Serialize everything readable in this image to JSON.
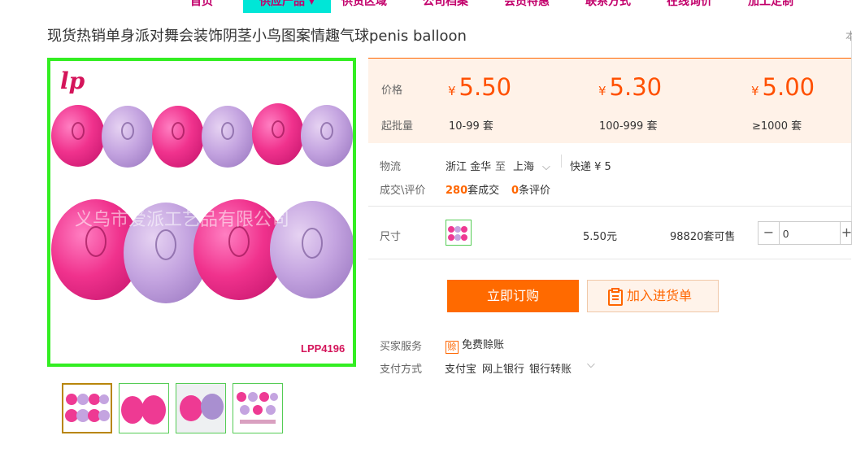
{
  "nav": {
    "items": [
      {
        "label": "首页"
      },
      {
        "label": "供应产品 ▾"
      },
      {
        "label": "供货区域"
      },
      {
        "label": "公司档案"
      },
      {
        "label": "会员特惠"
      },
      {
        "label": "联系方式"
      },
      {
        "label": "在线询价"
      },
      {
        "label": "加工定制"
      }
    ]
  },
  "product": {
    "title": "现货热销单身派对舞会装饰阴茎小鸟图案情趣气球penis balloon",
    "title_right": "本"
  },
  "images": {
    "brand_mark": "lp",
    "watermark": "义乌市爱派工艺品有限公司",
    "sku_code": "LPP4196",
    "thumbnails": [
      {
        "alt": "thumb-1"
      },
      {
        "alt": "thumb-2"
      },
      {
        "alt": "thumb-3"
      },
      {
        "alt": "thumb-4"
      }
    ]
  },
  "pricing": {
    "price_label": "价格",
    "moq_label": "起批量",
    "currency": "¥",
    "tiers": [
      {
        "price": "5.50",
        "range": "10-99 套"
      },
      {
        "price": "5.30",
        "range": "100-999 套"
      },
      {
        "price": "5.00",
        "range": "≥1000 套"
      }
    ]
  },
  "logistics": {
    "label": "物流",
    "from": "浙江 金华",
    "to_word": "至",
    "to": "上海",
    "shipping": "快递 ¥ 5"
  },
  "deals": {
    "label": "成交\\评价",
    "sold_count": "280",
    "sold_suffix": "套成交",
    "review_count": "0",
    "review_suffix": "条评价"
  },
  "sku": {
    "label": "尺寸",
    "price": "5.50元",
    "stock": "98820套可售",
    "minus": "−",
    "quantity": "0",
    "plus": "+"
  },
  "actions": {
    "order": "立即订购",
    "cart": "加入进货单"
  },
  "services": {
    "buyer_label": "买家服务",
    "free_badge": "赊",
    "free_text": "免费赊账",
    "pay_label": "支付方式",
    "pay_methods": [
      "支付宝",
      "网上银行",
      "银行转账"
    ]
  },
  "colors": {
    "accent": "#ff6600",
    "brand_pink": "#c2006b",
    "nav_active": "#00e6d7",
    "image_border": "#33ee22",
    "price_bg": "#fff2e8"
  }
}
